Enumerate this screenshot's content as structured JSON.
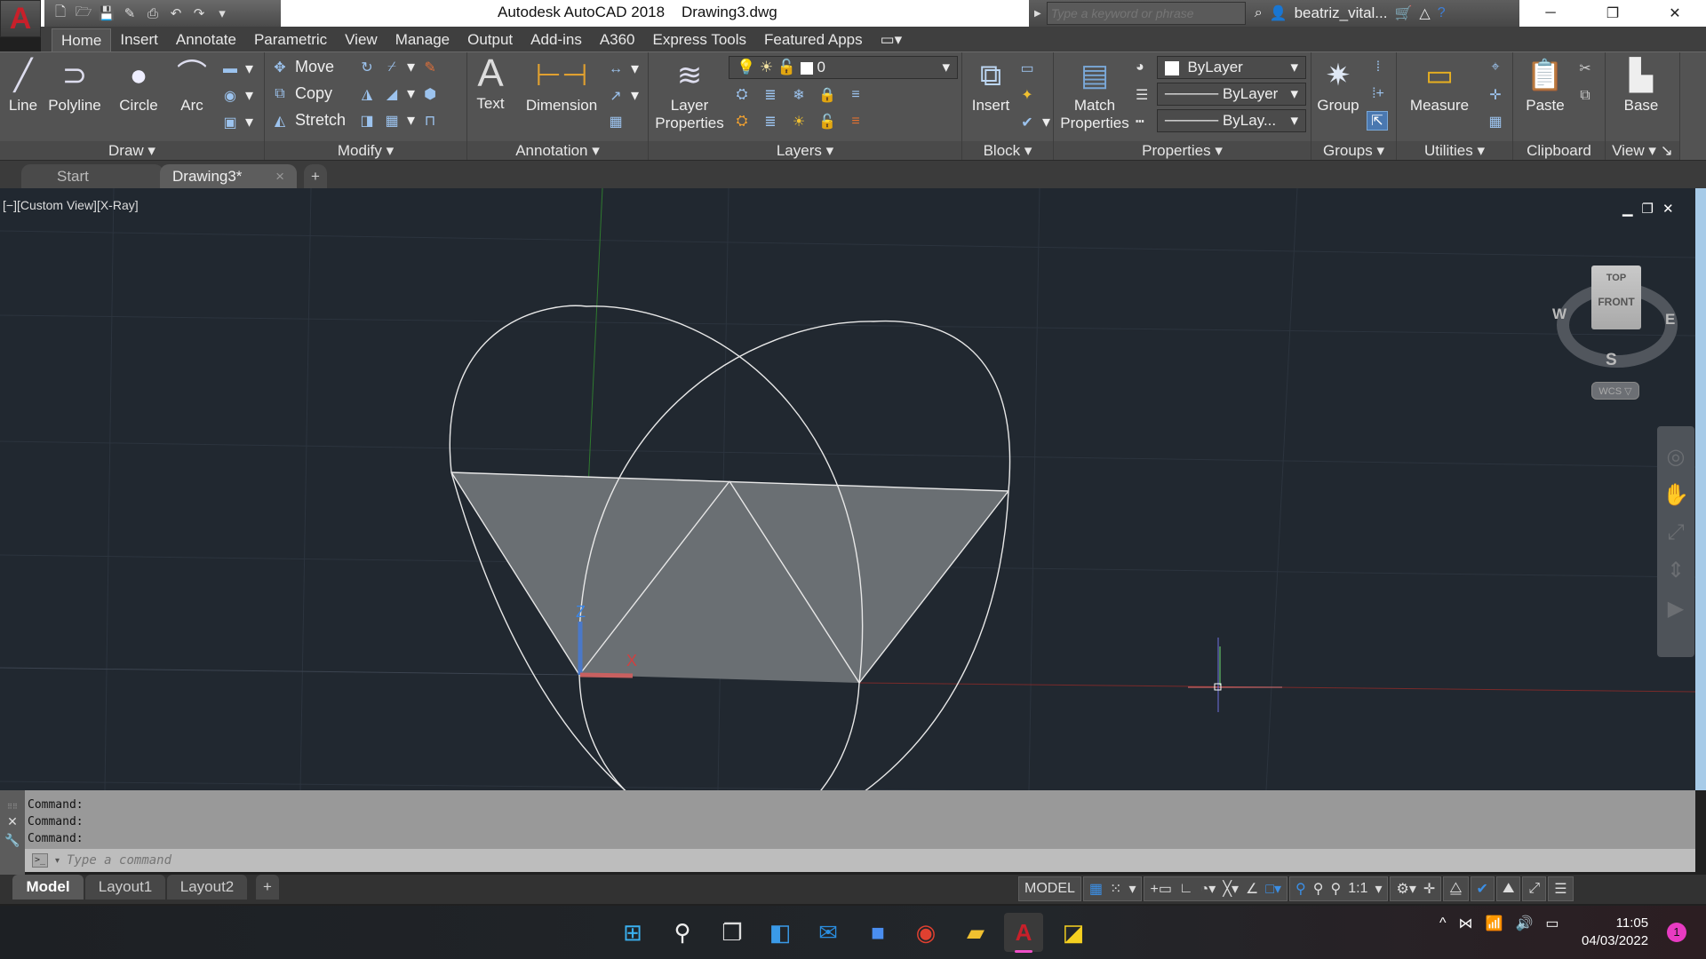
{
  "window": {
    "app_title": "Autodesk AutoCAD 2018",
    "file_name": "Drawing3.dwg",
    "search_placeholder": "Type a keyword or phrase",
    "user": "beatriz_vital...",
    "controls": {
      "minimize": "─",
      "restore": "❐",
      "close": "✕"
    }
  },
  "quick_access": [
    "new-icon",
    "open-icon",
    "save-icon",
    "save-as-icon",
    "print-icon",
    "undo-icon",
    "redo-icon",
    "customize-icon"
  ],
  "menu_tabs": [
    {
      "label": "Home",
      "active": true
    },
    {
      "label": "Insert"
    },
    {
      "label": "Annotate"
    },
    {
      "label": "Parametric"
    },
    {
      "label": "View"
    },
    {
      "label": "Manage"
    },
    {
      "label": "Output"
    },
    {
      "label": "Add-ins"
    },
    {
      "label": "A360"
    },
    {
      "label": "Express Tools"
    },
    {
      "label": "Featured Apps"
    }
  ],
  "ribbon": {
    "draw": {
      "label": "Draw",
      "line": "Line",
      "polyline": "Polyline",
      "circle": "Circle",
      "arc": "Arc"
    },
    "modify": {
      "label": "Modify",
      "move": "Move",
      "copy": "Copy",
      "stretch": "Stretch"
    },
    "annotation": {
      "label": "Annotation",
      "text": "Text",
      "dimension": "Dimension"
    },
    "layers": {
      "label": "Layers",
      "layer_properties": "Layer Properties",
      "current_layer": "0"
    },
    "block": {
      "label": "Block",
      "insert": "Insert"
    },
    "properties": {
      "label": "Properties",
      "match_properties": "Match Properties",
      "color": "ByLayer",
      "lineweight": "ByLayer",
      "linetype": "ByLay..."
    },
    "groups": {
      "label": "Groups",
      "group": "Group"
    },
    "utilities": {
      "label": "Utilities",
      "measure": "Measure"
    },
    "clipboard": {
      "label": "Clipboard",
      "paste": "Paste"
    },
    "view": {
      "label": "View",
      "base": "Base"
    }
  },
  "doc_tabs": [
    {
      "label": "Start"
    },
    {
      "label": "Drawing3*",
      "active": true,
      "close": "×"
    }
  ],
  "viewport": {
    "label": "[−][Custom View][X-Ray]",
    "viewcube": {
      "top": "TOP",
      "front": "FRONT",
      "w": "W",
      "e": "E",
      "s": "S",
      "wcs": "WCS ▽"
    },
    "ucs": {
      "z": "Z",
      "x": "X"
    }
  },
  "command": {
    "history": [
      "Command:",
      "Command:",
      "Command:"
    ],
    "placeholder": "Type a command"
  },
  "layout_tabs": [
    {
      "label": "Model",
      "active": true
    },
    {
      "label": "Layout1"
    },
    {
      "label": "Layout2"
    }
  ],
  "status_bar": {
    "model": "MODEL",
    "scale": "1:1"
  },
  "taskbar": {
    "apps": [
      "windows-start-icon",
      "search-icon",
      "task-view-icon",
      "widgets-icon",
      "mail-icon",
      "zoom-icon",
      "chrome-icon",
      "file-explorer-icon",
      "autocad-icon",
      "sticky-notes-icon"
    ],
    "time": "11:05",
    "date": "04/03/2022",
    "notifications": "1"
  }
}
